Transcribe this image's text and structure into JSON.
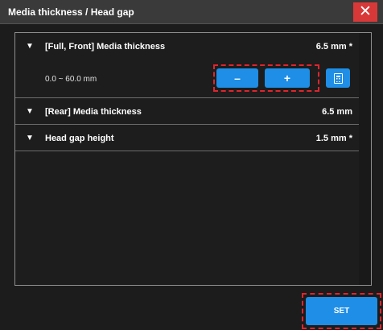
{
  "dialog": {
    "title": "Media thickness / Head gap",
    "close_label": "✕"
  },
  "rows": [
    {
      "expand_icon": "▼",
      "label": "[Full, Front] Media thickness",
      "value": "6.5 mm *",
      "range": "0.0 ~ 60.0 mm",
      "minus_label": "–",
      "plus_label": "+",
      "calculator_icon": "calculator-icon"
    },
    {
      "expand_icon": "▼",
      "label": "[Rear] Media thickness",
      "value": "6.5 mm"
    },
    {
      "expand_icon": "▼",
      "label": "Head gap height",
      "value": "1.5 mm *"
    }
  ],
  "footer": {
    "set_label": "SET"
  },
  "colors": {
    "accent": "#1f8ee6",
    "close": "#d93838",
    "highlight": "#e0242d",
    "background": "#1c1c1c",
    "titlebar": "#3a3a3a"
  }
}
